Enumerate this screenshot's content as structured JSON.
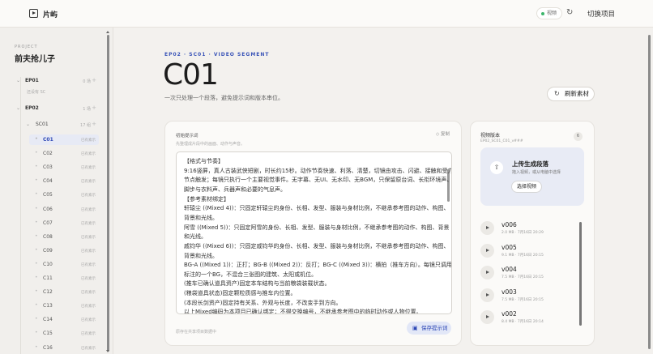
{
  "app": {
    "name": "片屿",
    "status": "视频",
    "switch_label": "切换项目"
  },
  "sidebar": {
    "kicker": "PROJECT",
    "project_title": "前夫抢儿子",
    "episodes": [
      {
        "label": "EP01",
        "sub": "还设有 SC",
        "count": "0 场"
      },
      {
        "label": "EP02",
        "count": "1 场"
      }
    ],
    "scene": {
      "label": "SC01",
      "count": "17 组"
    },
    "shots": [
      {
        "label": "C01",
        "status": "已有素示"
      },
      {
        "label": "C02",
        "status": "已有素示"
      },
      {
        "label": "C03",
        "status": "已有素示"
      },
      {
        "label": "C04",
        "status": "已有素示"
      },
      {
        "label": "C05",
        "status": "已有素示"
      },
      {
        "label": "C06",
        "status": "已有素示"
      },
      {
        "label": "C07",
        "status": "已有素示"
      },
      {
        "label": "C08",
        "status": "已有素示"
      },
      {
        "label": "C09",
        "status": "已有素示"
      },
      {
        "label": "C10",
        "status": "已有素示"
      },
      {
        "label": "C11",
        "status": "已有素示"
      },
      {
        "label": "C12",
        "status": "已有素示"
      },
      {
        "label": "C13",
        "status": "已有素示"
      },
      {
        "label": "C14",
        "status": "已有素示"
      },
      {
        "label": "C15",
        "status": "已有素示"
      },
      {
        "label": "C16",
        "status": "已有素示"
      }
    ]
  },
  "main": {
    "kicker": "EP02 · SC01 · VIDEO SEGMENT",
    "title": "C01",
    "description": "一次只处理一个段落，避免提示词和版本串位。",
    "refresh_label": "刷新素材"
  },
  "prompt": {
    "label": "初始提示词",
    "hint": "先整理成片段中的画面、动作与声音。",
    "copy_label": "复制",
    "lines": [
      "【格式与节奏】",
      "9:16竖屏，真人古装武侠短剧，时长约15秒。动作节奏快速、利落、清楚，切镜由攻击、闪避、接触和受力",
      "节点触发；每镜只执行一个主要视觉事件。无字幕、无UI、无水印、无BGM，只保留原台词、长衔环境声、",
      "脚步与衣料声、兵器声和必要的气息声。",
      "【参考素材绑定】",
      "轩辕尘 ((Mixed 4))：只固定轩辕尘的身份、长相、发型、服装与身材比例，不继承参考图的动作、构图、",
      "背景和光线。",
      "阿雪 ((Mixed 5))：只固定阿雪的身份、长相、发型、服装与身材比例，不继承参考图的动作、构图、背景",
      "和光线。",
      "戚钧华 ((Mixed 6))：只固定戚钧华的身份、长相、发型、服装与身材比例，不继承参考图的动作、构图、",
      "背景和光线。",
      "BG-A ((Mixed 1))：正打；BG-B ((Mixed 2))：反打；BG-C ((Mixed 3))：横拍（推车方向）。每镜只调用",
      "标注的一个BG，不混合三张图的建筑、太阳或机位。",
      "(推车已确认道具资产)固定本车结构与当前粮袋装载状态。",
      "(粮袋道具状态)固定颗粒质感与推车内位置。",
      "(本段长剑资产)固定持有关系、外观与长度，不改变手到方向。",
      "以上Mixed编码为本项目已确认绑定；不得交换编号，不继承参考图中的临时动作或人物位置。"
    ],
    "footer": "原存在共享项目数据中",
    "save_label": "保存提示词"
  },
  "versions": {
    "title": "视频版本",
    "subtitle": "EP02_SC01_C01_v###",
    "count": "6",
    "upload_title": "上传生成段落",
    "upload_hint": "拖入视频，或从电脑中选择",
    "upload_button": "选择视频",
    "items": [
      {
        "name": "v006",
        "meta": "2.0 MB · 7月16日 20:29"
      },
      {
        "name": "v005",
        "meta": "9.1 MB · 7月16日 20:15"
      },
      {
        "name": "v004",
        "meta": "7.5 MB · 7月16日 20:15"
      },
      {
        "name": "v003",
        "meta": "7.5 MB · 7月16日 20:15"
      },
      {
        "name": "v002",
        "meta": "8.4 MB · 7月16日 20:14"
      }
    ]
  }
}
